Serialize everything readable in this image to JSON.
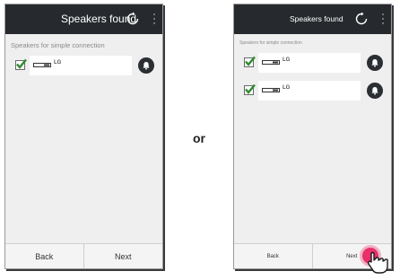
{
  "separator_text": "or",
  "phones": [
    {
      "title": "Speakers found",
      "section_label": "Speakers for simple connection",
      "speakers": [
        {
          "name": "LG",
          "checked": true
        }
      ],
      "back_label": "Back",
      "next_label": "Next"
    },
    {
      "title": "Speakers found",
      "section_label": "Speakers for simple connection",
      "speakers": [
        {
          "name": "LG",
          "checked": true
        },
        {
          "name": "LG",
          "checked": true
        }
      ],
      "back_label": "Back",
      "next_label": "Next"
    }
  ],
  "icons": {
    "refresh": "refresh-icon",
    "menu": "more-vertical-icon",
    "check": "check-icon",
    "speaker_device": "speaker-device-icon",
    "bell": "bell-icon",
    "tap": "hand-pointer-icon"
  },
  "colors": {
    "titlebar": "#262a2e",
    "check": "#2e8b2e",
    "tap": "#e8306a"
  }
}
